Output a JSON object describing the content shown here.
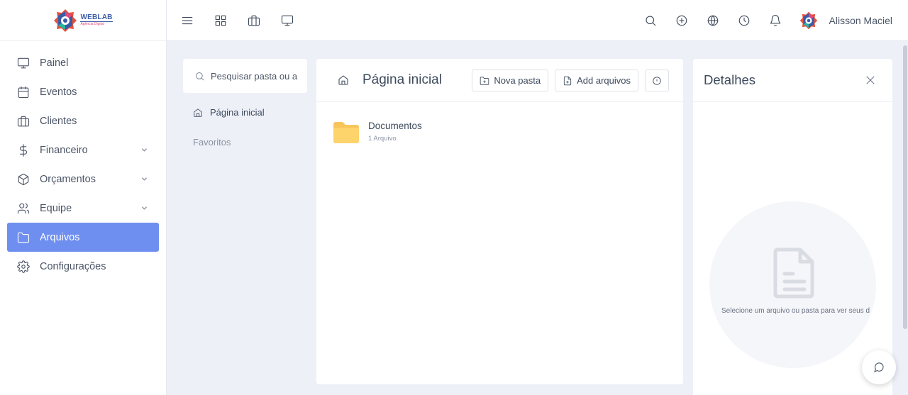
{
  "logo": {
    "text": "WEBLAB",
    "tagline": "Agência Digital"
  },
  "sidebar": {
    "items": [
      {
        "label": "Painel",
        "icon": "monitor-icon"
      },
      {
        "label": "Eventos",
        "icon": "calendar-icon"
      },
      {
        "label": "Clientes",
        "icon": "briefcase-icon"
      },
      {
        "label": "Financeiro",
        "icon": "dollar-icon",
        "expandable": true
      },
      {
        "label": "Orçamentos",
        "icon": "box-icon",
        "expandable": true
      },
      {
        "label": "Equipe",
        "icon": "users-icon",
        "expandable": true
      },
      {
        "label": "Arquivos",
        "icon": "folder-icon",
        "active": true
      },
      {
        "label": "Configurações",
        "icon": "gear-icon"
      }
    ]
  },
  "header": {
    "left_icons": [
      "menu-icon",
      "grid-icon",
      "briefcase-icon",
      "monitor-icon"
    ],
    "right_icons": [
      "search-icon",
      "plus-circle-icon",
      "globe-icon",
      "clock-icon",
      "bell-icon"
    ],
    "user_name": "Alisson Maciel"
  },
  "folders_panel": {
    "search_placeholder": "Pesquisar pasta ou a",
    "home_label": "Página inicial",
    "favorites_label": "Favoritos"
  },
  "main": {
    "title": "Página inicial",
    "new_folder_label": "Nova pasta",
    "add_files_label": "Add arquivos",
    "folders": [
      {
        "name": "Documentos",
        "count": "1 Arquivo"
      }
    ]
  },
  "details": {
    "title": "Detalhes",
    "empty_text": "Selecione um arquivo ou pasta para ver seus d"
  },
  "colors": {
    "accent": "#6f8ff0",
    "folder": "#fdd36b",
    "background": "#eef0f8"
  }
}
